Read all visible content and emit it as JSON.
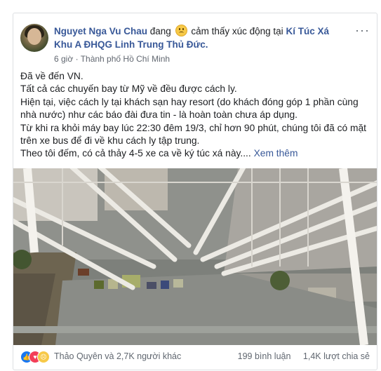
{
  "post": {
    "author": "Nguyet Nga Vu Chau",
    "feeling_prefix": "đang",
    "feeling_text": "cảm thấy xúc động tại",
    "location_name": "Kí Túc Xá Khu A ĐHQG Linh Trung Thủ Đức.",
    "time": "6 giờ",
    "separator": "·",
    "city": "Thành phố Hồ Chí Minh",
    "privacy_icon": "globe-icon",
    "more_label": "···",
    "feeling_icon": "sad-face-icon",
    "body": [
      "Đã về đến VN.",
      "Tất cả các chuyến bay từ Mỹ về đều được cách ly.",
      "Hiện tại, việc cách ly tại khách sạn hay resort (do khách đóng góp 1 phần cùng nhà nước) như các báo đài đưa tin - là hoàn toàn chưa áp dụng.",
      "Từ khi ra khỏi máy bay lúc 22:30 đêm 19/3, chỉ hơn 90 phút, chúng tôi đã có mặt trên xe bus để đi về khu cách ly tập trung.",
      "Theo tôi đếm, có cả thảy 4-5 xe ca về ký túc xá này...."
    ],
    "see_more": "Xem thêm"
  },
  "footer": {
    "reaction_icons": [
      "like-icon",
      "love-icon",
      "sad-icon"
    ],
    "reaction_names": "Thảo Quyên và 2,7K người khác",
    "comments": "199 bình luận",
    "shares": "1,4K lượt chia sẻ"
  }
}
